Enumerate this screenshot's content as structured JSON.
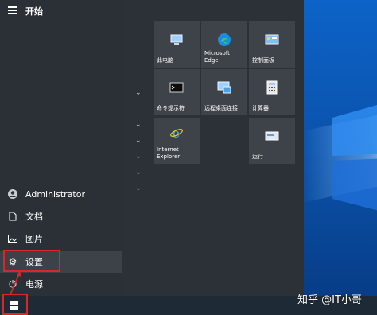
{
  "start_menu": {
    "title": "开始",
    "user": "Administrator",
    "documents": "文档",
    "pictures": "图片",
    "settings": "设置",
    "power": "电源"
  },
  "tiles": [
    {
      "label": "此电脑",
      "icon": "computer-icon"
    },
    {
      "label": "Microsoft Edge",
      "icon": "edge-icon"
    },
    {
      "label": "控制面板",
      "icon": "control-panel-icon"
    },
    {
      "label": "命令提示符",
      "icon": "cmd-icon"
    },
    {
      "label": "远程桌面连接",
      "icon": "remote-desktop-icon"
    },
    {
      "label": "计算器",
      "icon": "calculator-icon"
    },
    {
      "label": "Internet Explorer",
      "icon": "ie-icon"
    },
    {
      "label": "运行",
      "icon": "run-icon"
    }
  ],
  "watermark": "知乎 @IT小哥"
}
